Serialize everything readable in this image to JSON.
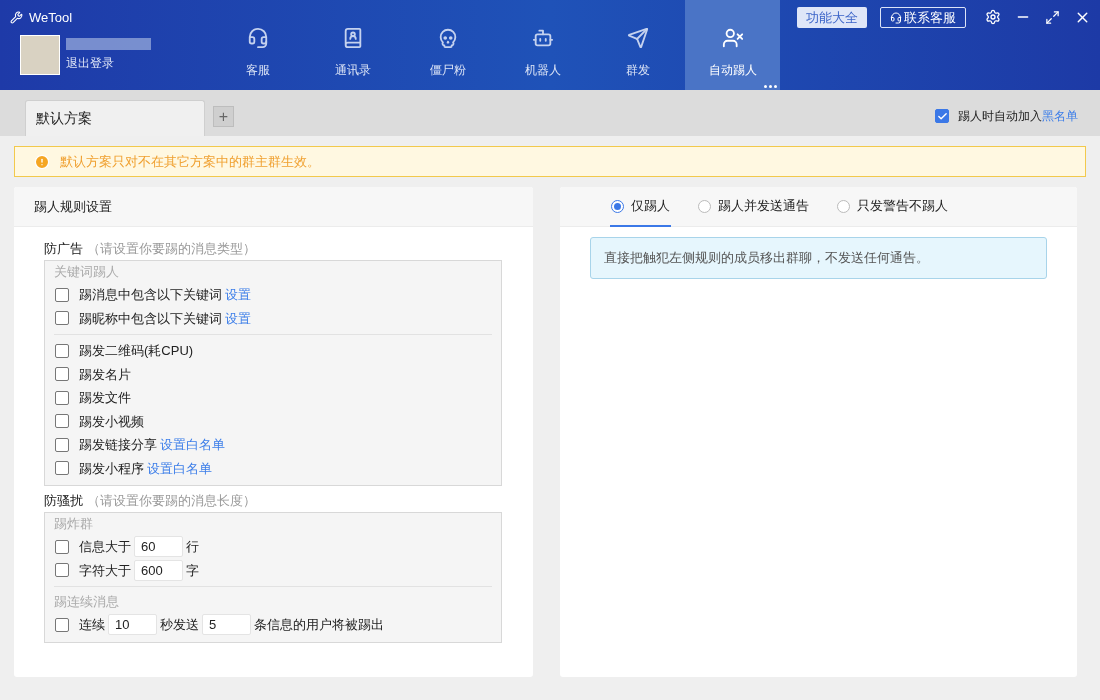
{
  "window": {
    "app_name": "WeTool",
    "logout": "退出登录"
  },
  "header_buttons": [
    {
      "label": "功能大全",
      "kind": "light"
    },
    {
      "label": "联系客服",
      "kind": "outline"
    }
  ],
  "nav": [
    {
      "label": "客服",
      "selected": false
    },
    {
      "label": "通讯录",
      "selected": false
    },
    {
      "label": "僵尸粉",
      "selected": false
    },
    {
      "label": "机器人",
      "selected": false
    },
    {
      "label": "群发",
      "selected": false
    },
    {
      "label": "自动踢人",
      "selected": true
    }
  ],
  "scheme_tabs": [
    {
      "label": "默认方案",
      "selected": true
    }
  ],
  "add_tab": "+",
  "blacklist_option": {
    "checked": true,
    "label": "踢人时自动加入",
    "link": "黑名单"
  },
  "notice": "默认方案只对不在其它方案中的群主群生效。",
  "rules": {
    "title": "踢人规则设置",
    "sections": [
      {
        "title": "防广告",
        "hint": "（请设置你要踢的消息类型）",
        "groups": [
          {
            "title": "关键词踢人",
            "items": [
              {
                "checked": false,
                "parts": [
                  {
                    "kind": "text",
                    "text": "踢消息中包含以下关键词"
                  },
                  {
                    "kind": "link",
                    "text": "设置"
                  }
                ]
              },
              {
                "checked": false,
                "parts": [
                  {
                    "kind": "text",
                    "text": "踢昵称中包含以下关键词"
                  },
                  {
                    "kind": "link",
                    "text": "设置"
                  }
                ]
              }
            ]
          },
          {
            "items": [
              {
                "checked": false,
                "parts": [
                  {
                    "kind": "text",
                    "text": "踢发二维码(耗CPU)"
                  }
                ]
              },
              {
                "checked": false,
                "parts": [
                  {
                    "kind": "text",
                    "text": "踢发名片"
                  }
                ]
              },
              {
                "checked": false,
                "parts": [
                  {
                    "kind": "text",
                    "text": "踢发文件"
                  }
                ]
              },
              {
                "checked": false,
                "parts": [
                  {
                    "kind": "text",
                    "text": "踢发小视频"
                  }
                ]
              },
              {
                "checked": false,
                "parts": [
                  {
                    "kind": "text",
                    "text": "踢发链接分享"
                  },
                  {
                    "kind": "link",
                    "text": "设置白名单"
                  }
                ]
              },
              {
                "checked": false,
                "parts": [
                  {
                    "kind": "text",
                    "text": "踢发小程序"
                  },
                  {
                    "kind": "link",
                    "text": "设置白名单"
                  }
                ]
              }
            ]
          }
        ]
      },
      {
        "title": "防骚扰",
        "hint": "（请设置你要踢的消息长度）",
        "groups": [
          {
            "title": "踢炸群",
            "items": [
              {
                "checked": false,
                "parts": [
                  {
                    "kind": "text",
                    "text": "信息大于"
                  },
                  {
                    "kind": "input",
                    "text": "60"
                  },
                  {
                    "kind": "text",
                    "text": "行"
                  }
                ]
              },
              {
                "checked": false,
                "parts": [
                  {
                    "kind": "text",
                    "text": "字符大于"
                  },
                  {
                    "kind": "input",
                    "text": "600"
                  },
                  {
                    "kind": "text",
                    "text": "字"
                  }
                ]
              }
            ]
          },
          {
            "title": "踢连续消息",
            "items": [
              {
                "checked": false,
                "parts": [
                  {
                    "kind": "text",
                    "text": "连续"
                  },
                  {
                    "kind": "input",
                    "text": "10"
                  },
                  {
                    "kind": "text",
                    "text": "秒发送"
                  },
                  {
                    "kind": "input",
                    "text": "5"
                  },
                  {
                    "kind": "text",
                    "text": "条信息的用户将被踢出"
                  }
                ]
              }
            ]
          }
        ]
      }
    ]
  },
  "modes": [
    {
      "label": "仅踢人",
      "selected": true
    },
    {
      "label": "踢人并发送通告",
      "selected": false
    },
    {
      "label": "只发警告不踢人",
      "selected": false
    }
  ],
  "mode_description": "直接把触犯左侧规则的成员移出群聊，不发送任何通告。"
}
